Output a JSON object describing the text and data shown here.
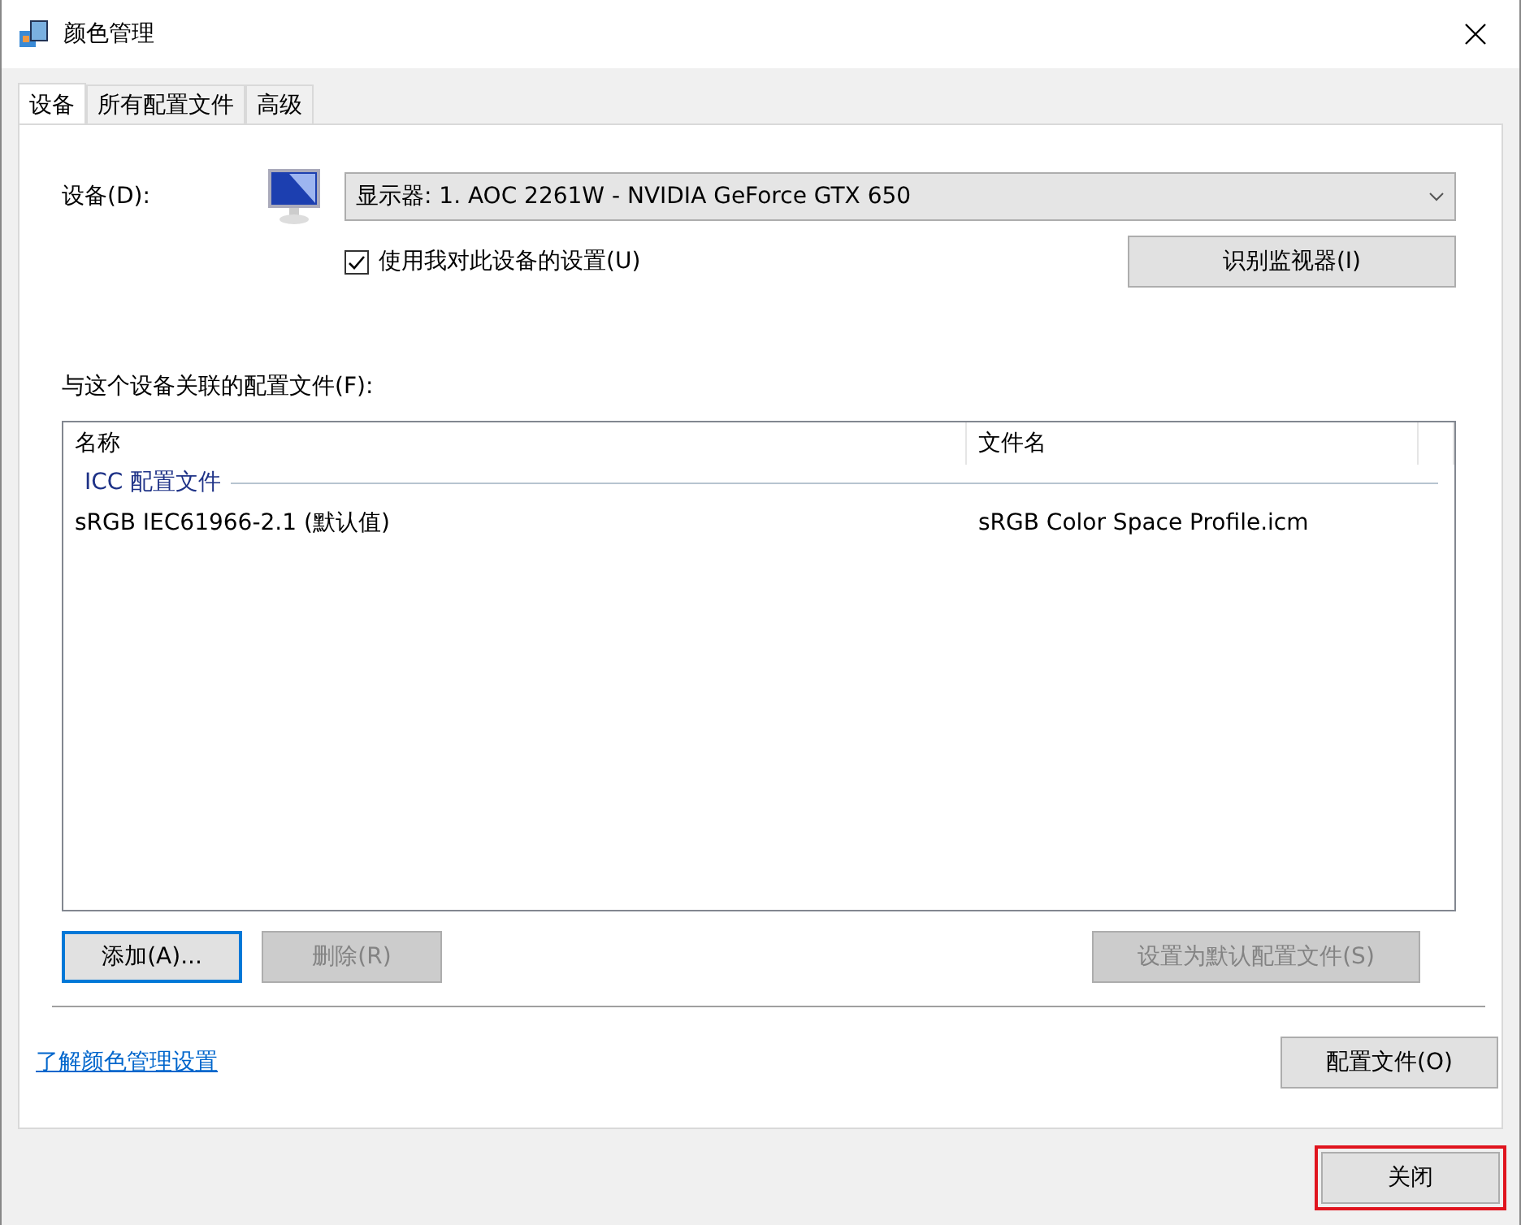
{
  "window": {
    "title": "颜色管理"
  },
  "tabs": [
    {
      "label": "设备",
      "selected": true
    },
    {
      "label": "所有配置文件",
      "selected": false
    },
    {
      "label": "高级",
      "selected": false
    }
  ],
  "device": {
    "label": "设备(D):",
    "value": "显示器: 1. AOC 2261W - NVIDIA GeForce GTX 650",
    "use_settings": {
      "label": "使用我对此设备的设置(U)",
      "checked": true
    },
    "identify_button": "识别监视器(I)"
  },
  "profiles": {
    "label": "与这个设备关联的配置文件(F):",
    "columns": [
      "名称",
      "文件名"
    ],
    "groups": [
      {
        "title": "ICC 配置文件",
        "rows": [
          {
            "name": "sRGB IEC61966-2.1 (默认值)",
            "file": "sRGB Color Space Profile.icm"
          }
        ]
      }
    ]
  },
  "buttons": [
    {
      "label": "添加(A)...",
      "disabled": false,
      "focused": true
    },
    {
      "label": "删除(R)",
      "disabled": true,
      "focused": false
    },
    {
      "label": "设置为默认配置文件(S)",
      "disabled": true,
      "focused": false
    }
  ],
  "link": "了解颜色管理设置",
  "profiles_button": "配置文件(O)",
  "close_button": {
    "label": "关闭",
    "highlighted": true
  }
}
